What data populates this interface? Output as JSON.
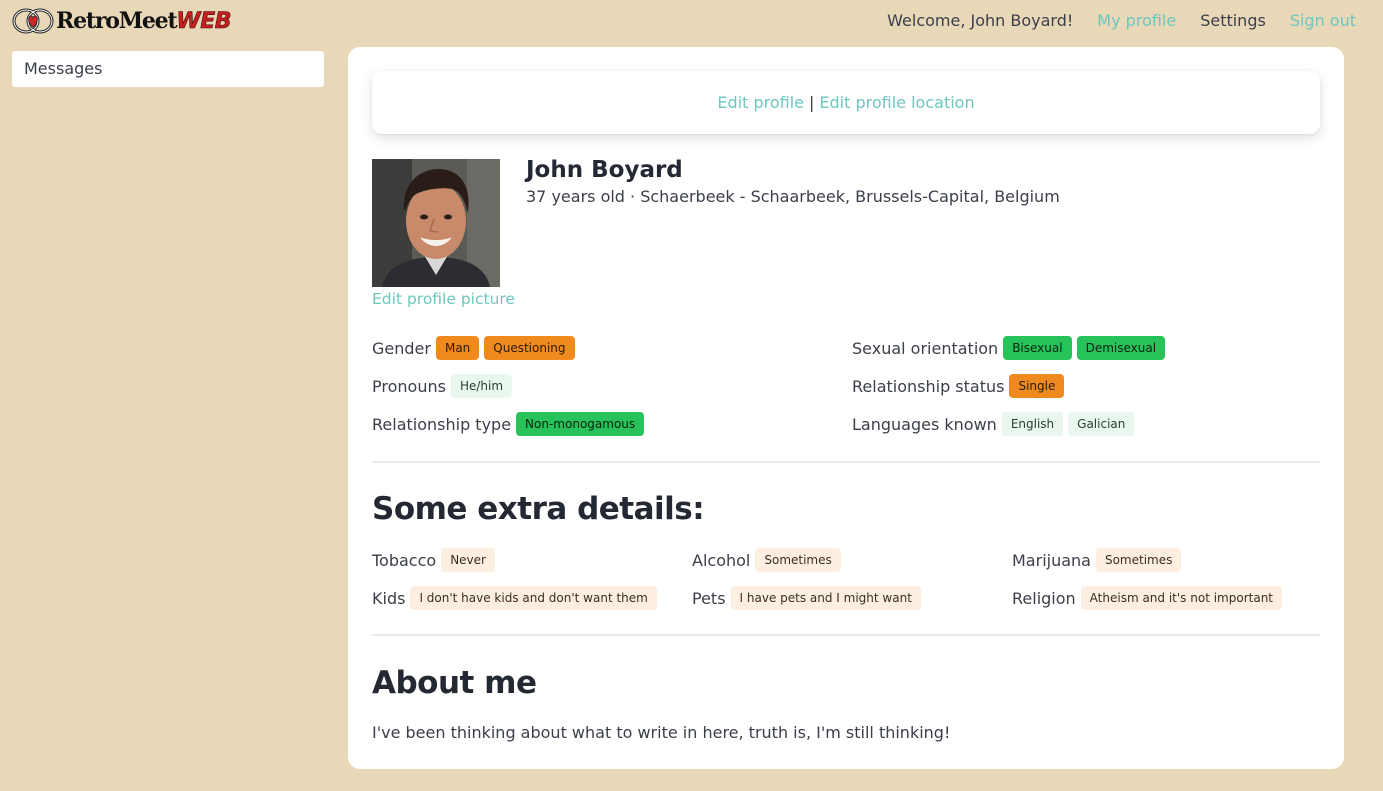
{
  "header": {
    "logo_text": "RetroMeet",
    "logo_suffix": "WEB",
    "welcome": "Welcome, John Boyard!",
    "nav": {
      "my_profile": "My profile",
      "settings": "Settings",
      "sign_out": "Sign out"
    }
  },
  "sidebar": {
    "messages": "Messages"
  },
  "profile": {
    "edit_profile": "Edit profile",
    "separator": "|",
    "edit_location": "Edit profile location",
    "name": "John Boyard",
    "subline": "37 years old · Schaerbeek - Schaarbeek, Brussels-Capital, Belgium",
    "edit_picture": "Edit profile picture",
    "gender": {
      "label": "Gender",
      "tags": [
        "Man",
        "Questioning"
      ]
    },
    "orientation": {
      "label": "Sexual orientation",
      "tags": [
        "Bisexual",
        "Demisexual"
      ]
    },
    "pronouns": {
      "label": "Pronouns",
      "tags": [
        "He/him"
      ]
    },
    "relationship_status": {
      "label": "Relationship status",
      "tags": [
        "Single"
      ]
    },
    "relationship_type": {
      "label": "Relationship type",
      "tags": [
        "Non-monogamous"
      ]
    },
    "languages": {
      "label": "Languages known",
      "tags": [
        "English",
        "Galician"
      ]
    }
  },
  "extra": {
    "title": "Some extra details:",
    "tobacco": {
      "label": "Tobacco",
      "value": "Never"
    },
    "alcohol": {
      "label": "Alcohol",
      "value": "Sometimes"
    },
    "marijuana": {
      "label": "Marijuana",
      "value": "Sometimes"
    },
    "kids": {
      "label": "Kids",
      "value": "I don't have kids and don't want them"
    },
    "pets": {
      "label": "Pets",
      "value": "I have pets and I might want"
    },
    "religion": {
      "label": "Religion",
      "value": "Atheism and it's not important"
    }
  },
  "about": {
    "title": "About me",
    "text": "I've been thinking about what to write in here, truth is, I'm still thinking!"
  },
  "colors": {
    "background": "#e8d8b8",
    "link": "#6cc7bf",
    "tag_orange": "#ef8a1e",
    "tag_green": "#27c35a",
    "tag_mint": "#e9f7ee",
    "tag_cream": "#fcefe2",
    "logo_red": "#c91f1f"
  },
  "icons": {
    "logo": "heart-rings-icon"
  }
}
